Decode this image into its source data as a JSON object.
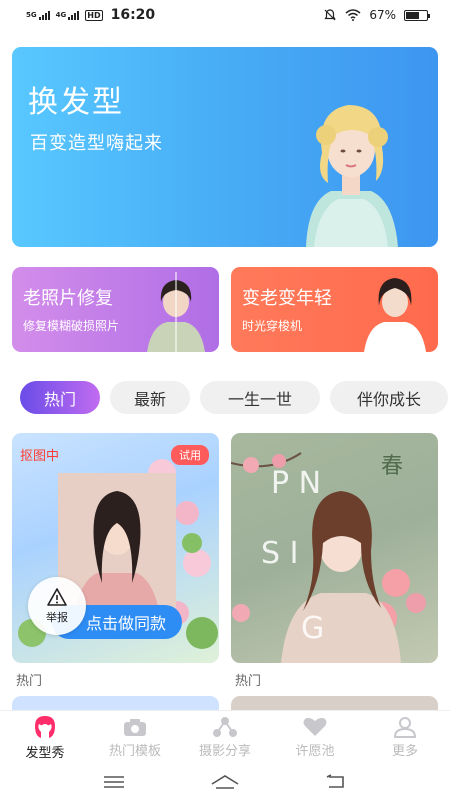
{
  "status_bar": {
    "signal1_label": "5G",
    "signal2_label": "4G",
    "hd_label": "HD",
    "time": "16:20",
    "battery_percent": "67%",
    "battery_level": 0.67
  },
  "hero": {
    "title": "换发型",
    "subtitle": "百变造型嗨起来"
  },
  "features": [
    {
      "title": "老照片修复",
      "subtitle": "修复模糊破损照片"
    },
    {
      "title": "变老变年轻",
      "subtitle": "时光穿梭机"
    }
  ],
  "tabs": [
    {
      "label": "热门",
      "active": true
    },
    {
      "label": "最新",
      "active": false
    },
    {
      "label": "一生一世",
      "active": false
    },
    {
      "label": "伴你成长",
      "active": false
    }
  ],
  "cards": [
    {
      "status": "抠图中",
      "badge": "试用",
      "button": "点击做同款",
      "report": "举报",
      "category": "热门"
    },
    {
      "overlay_text": "SPRING",
      "category": "热门"
    }
  ],
  "bottom_nav": [
    {
      "label": "发型秀",
      "icon": "hair-icon",
      "active": true
    },
    {
      "label": "热门模板",
      "icon": "camera-icon",
      "active": false
    },
    {
      "label": "摄影分享",
      "icon": "share-icon",
      "active": false
    },
    {
      "label": "许愿池",
      "icon": "heart-icon",
      "active": false
    },
    {
      "label": "更多",
      "icon": "person-icon",
      "active": false
    }
  ],
  "colors": {
    "hero_blue": "#49aff6",
    "feature_purple": "#b06ee6",
    "feature_orange": "#ff6a4d",
    "tab_active": "#8a58ec",
    "button_blue": "#2e8df5",
    "brand_pink": "#ff2d6a"
  }
}
